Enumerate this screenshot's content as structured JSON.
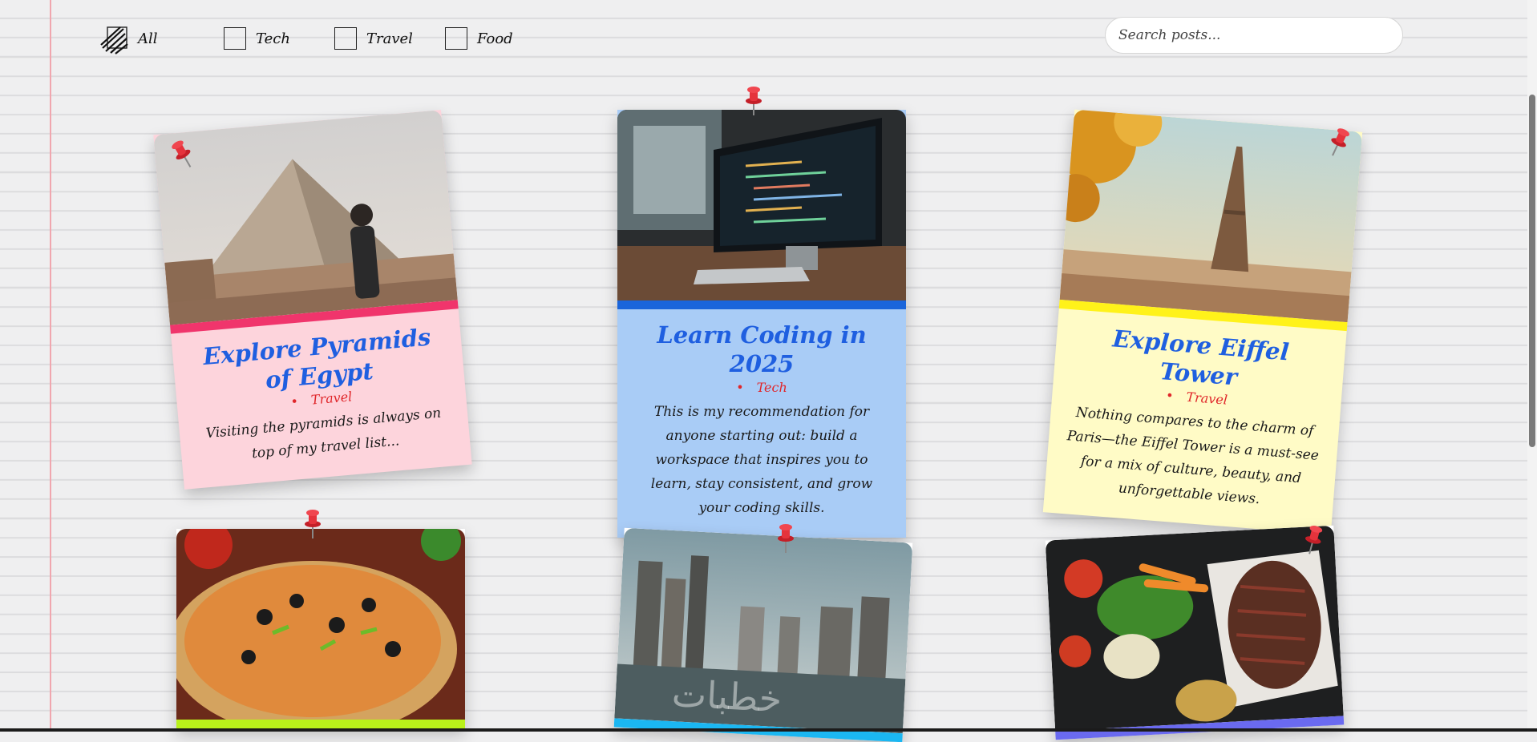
{
  "filters": [
    {
      "label": "All",
      "checked": true
    },
    {
      "label": "Tech",
      "checked": false
    },
    {
      "label": "Travel",
      "checked": false
    },
    {
      "label": "Food",
      "checked": false
    }
  ],
  "search": {
    "placeholder": "Search posts..."
  },
  "posts": [
    {
      "title": "Explore Pyramids of Egypt",
      "category": "Travel",
      "excerpt": "Visiting the pyramids is always on top of my travel list...",
      "bg_color": "#fdd4dc",
      "stripe_color": "#f0356c",
      "image": "pyramid-photo"
    },
    {
      "title": "Learn Coding in 2025",
      "category": "Tech",
      "excerpt": "This is my recommendation for anyone starting out: build a workspace that inspires you to learn, stay consistent, and grow your coding skills.",
      "bg_color": "#a9ccf6",
      "stripe_color": "#1a65db",
      "image": "computer-code-photo"
    },
    {
      "title": "Explore Eiffel Tower",
      "category": "Travel",
      "excerpt": "Nothing compares to the charm of Paris—the Eiffel Tower is a must-see for a mix of culture, beauty, and unforgettable views.",
      "bg_color": "#fffbc6",
      "stripe_color": "#fff21a",
      "image": "eiffel-tower-photo"
    },
    {
      "title": "",
      "category": "",
      "excerpt": "",
      "bg_color": "#ffffff",
      "stripe_color": "#b9f21a",
      "image": "pizza-photo"
    },
    {
      "title": "",
      "category": "",
      "excerpt": "",
      "bg_color": "#ffffff",
      "stripe_color": "#1bb7f2",
      "image": "city-marina-photo",
      "watermark": "خطبات"
    },
    {
      "title": "",
      "category": "",
      "excerpt": "",
      "bg_color": "#ffffff",
      "stripe_color": "#6a6af0",
      "image": "steak-vegetables-photo"
    }
  ],
  "colors": {
    "pin": "#e5333c",
    "title": "#1f5fe0",
    "category": "#e0262a",
    "margin_line": "#f0a6ae"
  }
}
